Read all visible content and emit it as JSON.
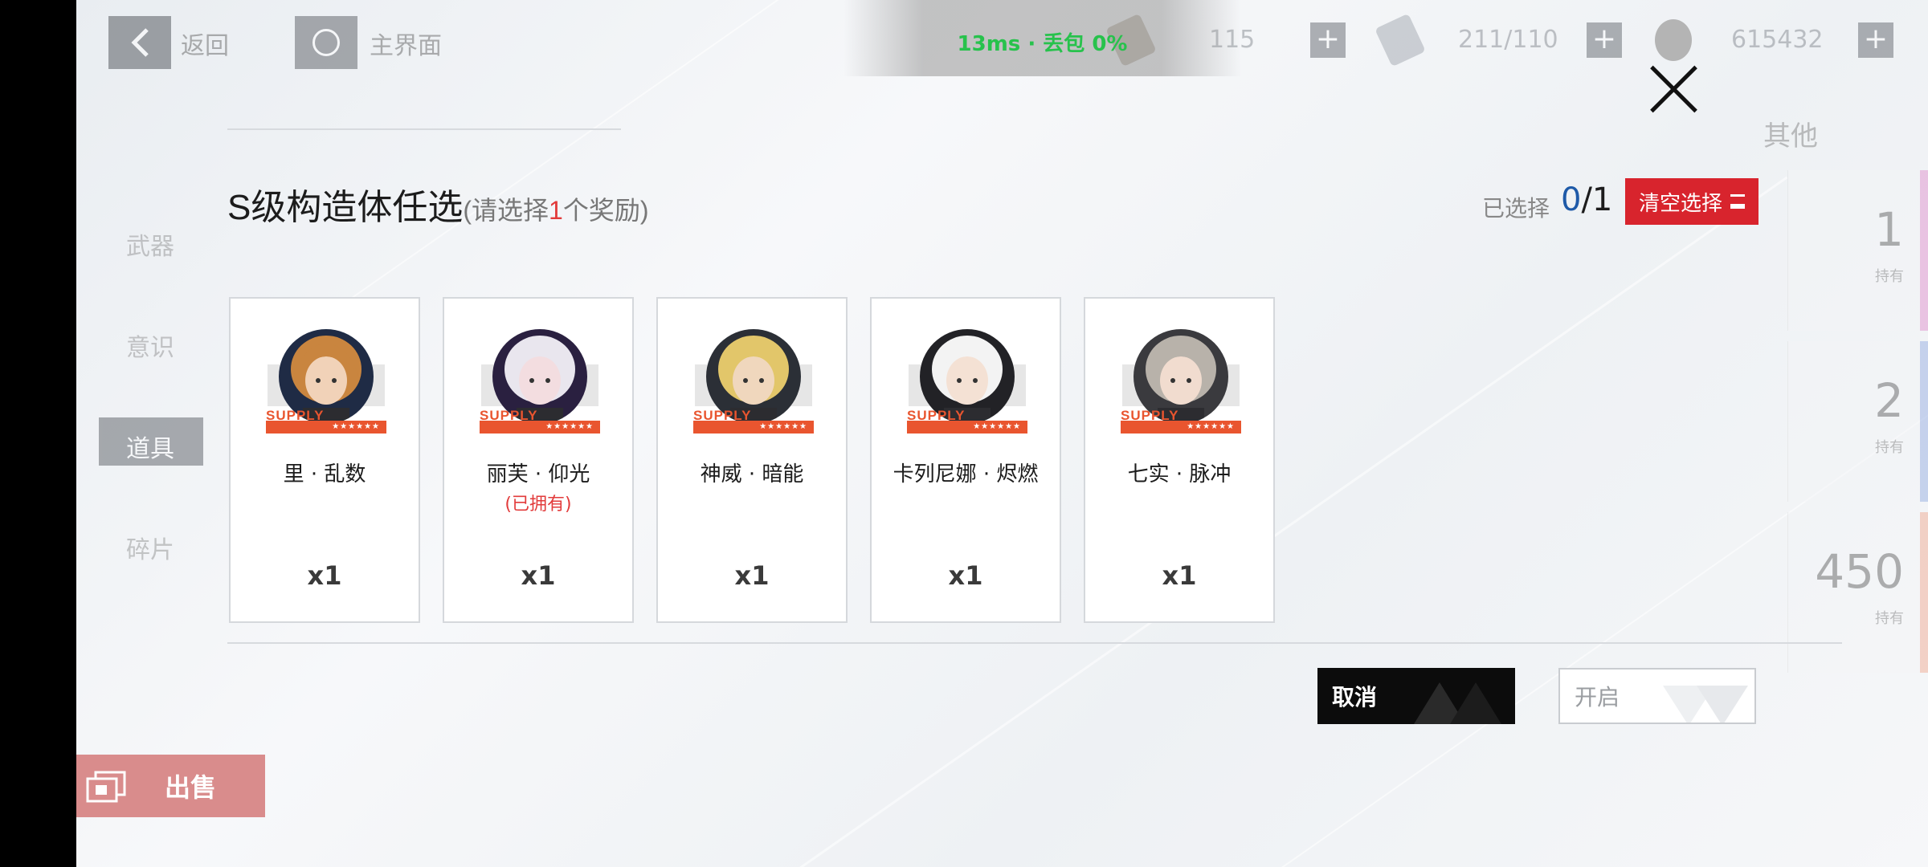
{
  "topbar": {
    "back_label": "返回",
    "home_label": "主界面",
    "resources": [
      {
        "icon": "stamina-icon",
        "value": "115"
      },
      {
        "icon": "key-icon",
        "value": "211/110"
      },
      {
        "icon": "coin-icon",
        "value": "615432"
      }
    ]
  },
  "network": {
    "text": "13ms · 丢包 0%"
  },
  "background": {
    "sidebar": [
      "武器",
      "意识",
      "道具",
      "碎片"
    ],
    "sell_label": "出售",
    "filter_label": "其他",
    "right_cards": [
      {
        "count": "1",
        "own_label": "持有",
        "stripe": "#e08acb"
      },
      {
        "count": "2",
        "own_label": "持有",
        "stripe": "#8fa8e0"
      },
      {
        "count": "450",
        "own_label": "持有",
        "stripe": "#f0a58a"
      }
    ]
  },
  "dialog": {
    "title": "S级构造体任选",
    "subtitle_prefix": "(请选择",
    "subtitle_number": "1",
    "subtitle_suffix": "个奖励)",
    "selected_label": "已选择",
    "selected_value": "0",
    "selected_total": "/1",
    "clear_button": "清空选择",
    "supply_text": "SUPPLY",
    "stars": "★★★★★★",
    "cards": [
      {
        "name": "里 · 乱数",
        "quantity": "x1",
        "owned": "",
        "hair": "#c9853f",
        "skin": "#f1d2b8",
        "bg": "#1f2b45"
      },
      {
        "name": "丽芙 · 仰光",
        "quantity": "x1",
        "owned": "(已拥有)",
        "hair": "#e9e6ee",
        "skin": "#f3dde0",
        "bg": "#2a2040"
      },
      {
        "name": "神威 · 暗能",
        "quantity": "x1",
        "owned": "",
        "hair": "#e2c66a",
        "skin": "#f0d7bd",
        "bg": "#2b2f36"
      },
      {
        "name": "卡列尼娜 · 烬燃",
        "quantity": "x1",
        "owned": "",
        "hair": "#f3f3f3",
        "skin": "#f4e1d4",
        "bg": "#222226"
      },
      {
        "name": "七实 · 脉冲",
        "quantity": "x1",
        "owned": "",
        "hair": "#b8b2aa",
        "skin": "#f1dccf",
        "bg": "#3a3a3e"
      }
    ],
    "cancel_button": "取消",
    "open_button": "开启"
  }
}
